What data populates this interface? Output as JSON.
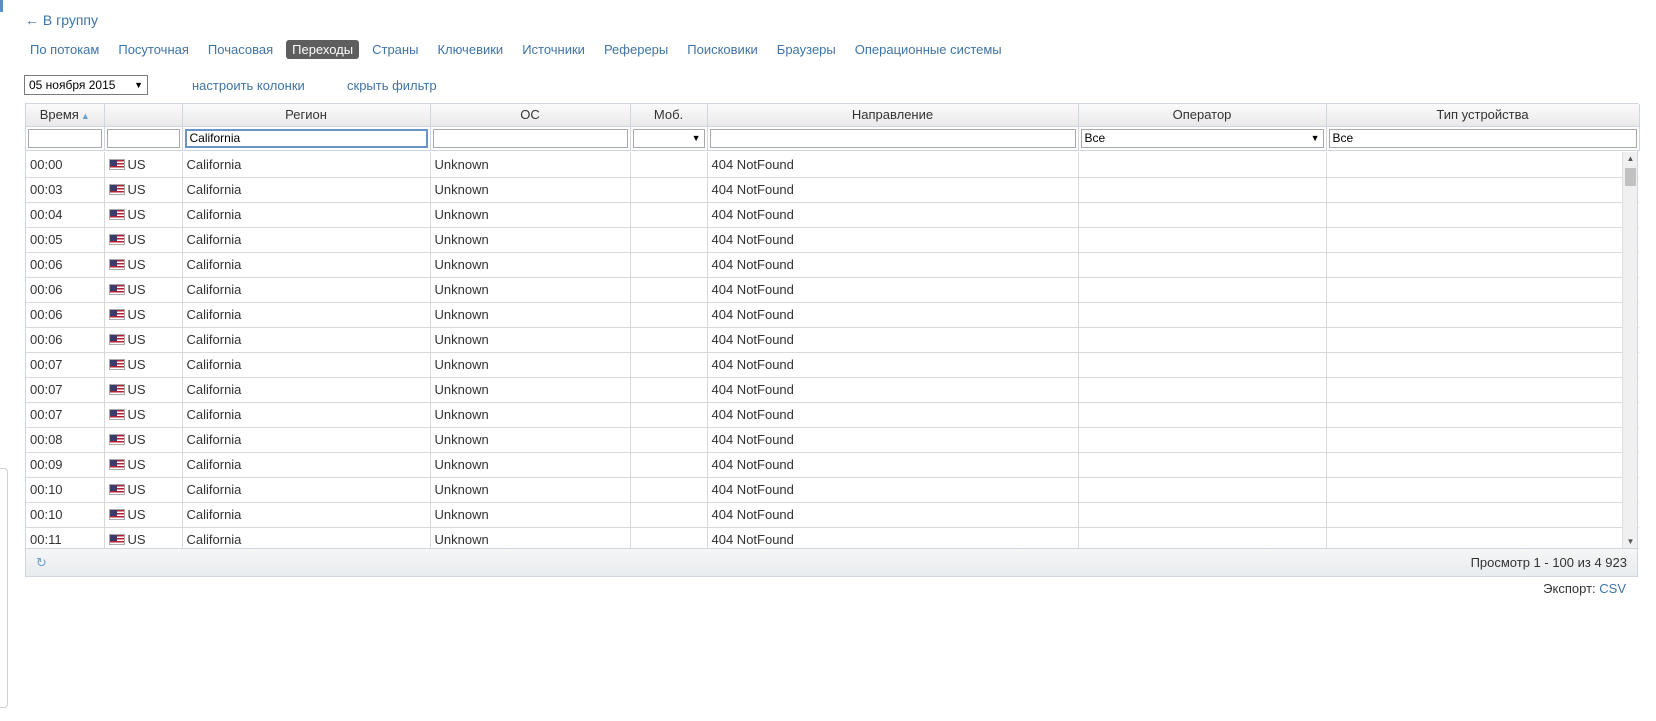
{
  "back_link": "← В группу",
  "tabs": [
    {
      "label": "По потокам",
      "active": false
    },
    {
      "label": "Посуточная",
      "active": false
    },
    {
      "label": "Почасовая",
      "active": false
    },
    {
      "label": "Переходы",
      "active": true
    },
    {
      "label": "Страны",
      "active": false
    },
    {
      "label": "Ключевики",
      "active": false
    },
    {
      "label": "Источники",
      "active": false
    },
    {
      "label": "Рефереры",
      "active": false
    },
    {
      "label": "Поисковики",
      "active": false
    },
    {
      "label": "Браузеры",
      "active": false
    },
    {
      "label": "Операционные системы",
      "active": false
    }
  ],
  "date_select": {
    "value": "05 ноября 2015"
  },
  "links": {
    "configure_columns": "настроить колонки",
    "hide_filter": "скрыть фильтр"
  },
  "columns": [
    "Время",
    "",
    "Регион",
    "ОС",
    "Моб.",
    "Направление",
    "Оператор",
    "Тип устройства"
  ],
  "filters": {
    "time": "",
    "country": "",
    "region": "California",
    "os": "",
    "mob": "",
    "direction": "",
    "operator": "Все",
    "device_type": "Все"
  },
  "rows": [
    {
      "time": "00:00",
      "country": "US",
      "region": "California",
      "os": "Unknown",
      "mob": "",
      "direction": "404 NotFound",
      "operator": "",
      "device": ""
    },
    {
      "time": "00:03",
      "country": "US",
      "region": "California",
      "os": "Unknown",
      "mob": "",
      "direction": "404 NotFound",
      "operator": "",
      "device": ""
    },
    {
      "time": "00:04",
      "country": "US",
      "region": "California",
      "os": "Unknown",
      "mob": "",
      "direction": "404 NotFound",
      "operator": "",
      "device": ""
    },
    {
      "time": "00:05",
      "country": "US",
      "region": "California",
      "os": "Unknown",
      "mob": "",
      "direction": "404 NotFound",
      "operator": "",
      "device": ""
    },
    {
      "time": "00:06",
      "country": "US",
      "region": "California",
      "os": "Unknown",
      "mob": "",
      "direction": "404 NotFound",
      "operator": "",
      "device": ""
    },
    {
      "time": "00:06",
      "country": "US",
      "region": "California",
      "os": "Unknown",
      "mob": "",
      "direction": "404 NotFound",
      "operator": "",
      "device": ""
    },
    {
      "time": "00:06",
      "country": "US",
      "region": "California",
      "os": "Unknown",
      "mob": "",
      "direction": "404 NotFound",
      "operator": "",
      "device": ""
    },
    {
      "time": "00:06",
      "country": "US",
      "region": "California",
      "os": "Unknown",
      "mob": "",
      "direction": "404 NotFound",
      "operator": "",
      "device": ""
    },
    {
      "time": "00:07",
      "country": "US",
      "region": "California",
      "os": "Unknown",
      "mob": "",
      "direction": "404 NotFound",
      "operator": "",
      "device": ""
    },
    {
      "time": "00:07",
      "country": "US",
      "region": "California",
      "os": "Unknown",
      "mob": "",
      "direction": "404 NotFound",
      "operator": "",
      "device": ""
    },
    {
      "time": "00:07",
      "country": "US",
      "region": "California",
      "os": "Unknown",
      "mob": "",
      "direction": "404 NotFound",
      "operator": "",
      "device": ""
    },
    {
      "time": "00:08",
      "country": "US",
      "region": "California",
      "os": "Unknown",
      "mob": "",
      "direction": "404 NotFound",
      "operator": "",
      "device": ""
    },
    {
      "time": "00:09",
      "country": "US",
      "region": "California",
      "os": "Unknown",
      "mob": "",
      "direction": "404 NotFound",
      "operator": "",
      "device": ""
    },
    {
      "time": "00:10",
      "country": "US",
      "region": "California",
      "os": "Unknown",
      "mob": "",
      "direction": "404 NotFound",
      "operator": "",
      "device": ""
    },
    {
      "time": "00:10",
      "country": "US",
      "region": "California",
      "os": "Unknown",
      "mob": "",
      "direction": "404 NotFound",
      "operator": "",
      "device": ""
    },
    {
      "time": "00:11",
      "country": "US",
      "region": "California",
      "os": "Unknown",
      "mob": "",
      "direction": "404 NotFound",
      "operator": "",
      "device": ""
    }
  ],
  "pager": {
    "info": "Просмотр 1 - 100 из 4 923"
  },
  "export": {
    "label": "Экспорт:",
    "csv": "CSV"
  },
  "colors": {
    "link": "#3f74a6",
    "active_tab_bg": "#5e5e5e",
    "accent": "#6aa0d0"
  },
  "icons": {
    "refresh": "refresh-icon",
    "sort": "sort-asc-icon",
    "flag": "us-flag-icon"
  }
}
